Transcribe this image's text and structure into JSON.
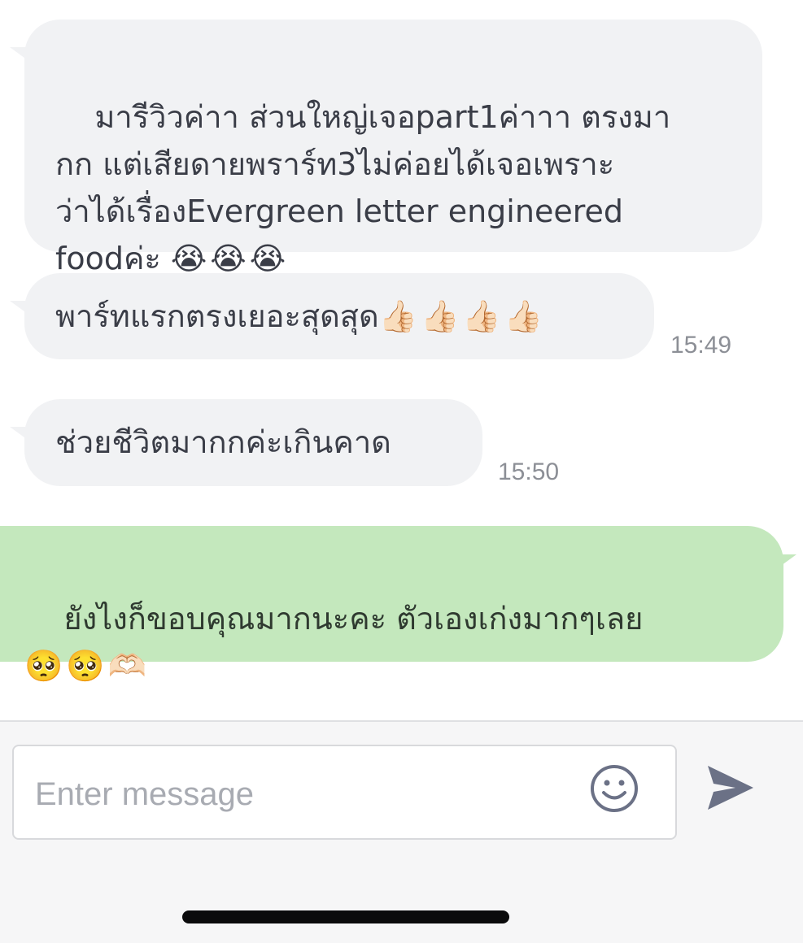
{
  "messages": [
    {
      "direction": "incoming",
      "text": "มารีวิวค่าา ส่วนใหญ่เจอpart1ค่าาา ตรงมา\nกก แต่เสียดายพราร์ท3ไม่ค่อยได้เจอเพราะ\nว่าได้เรื่องEvergreen letter engineered\nfoodค่ะ ",
      "emoji": "😭😭😭",
      "time": ""
    },
    {
      "direction": "incoming",
      "text": "พาร์ทแรกตรงเยอะสุดสุด",
      "emoji": "👍🏻👍🏻👍🏻👍🏻",
      "time": "15:49"
    },
    {
      "direction": "incoming",
      "text": "ช่วยชีวิตมากกค่ะเกินคาด",
      "emoji": "",
      "time": "15:50"
    },
    {
      "direction": "outgoing",
      "text": "ยังไงก็ขอบคุณมากนะคะ ตัวเองเก่งมากๆเลย\n",
      "emoji": "🥺🥺🫶🏻",
      "time": ""
    }
  ],
  "composer": {
    "placeholder": "Enter message",
    "value": "",
    "emoji_icon": "smiley-face-icon",
    "send_icon": "paper-plane-send-icon"
  },
  "colors": {
    "incoming_bubble": "#f1f2f4",
    "outgoing_bubble": "#c4e8bd",
    "icon": "#6b7186",
    "timestamp": "#8c8f96"
  }
}
